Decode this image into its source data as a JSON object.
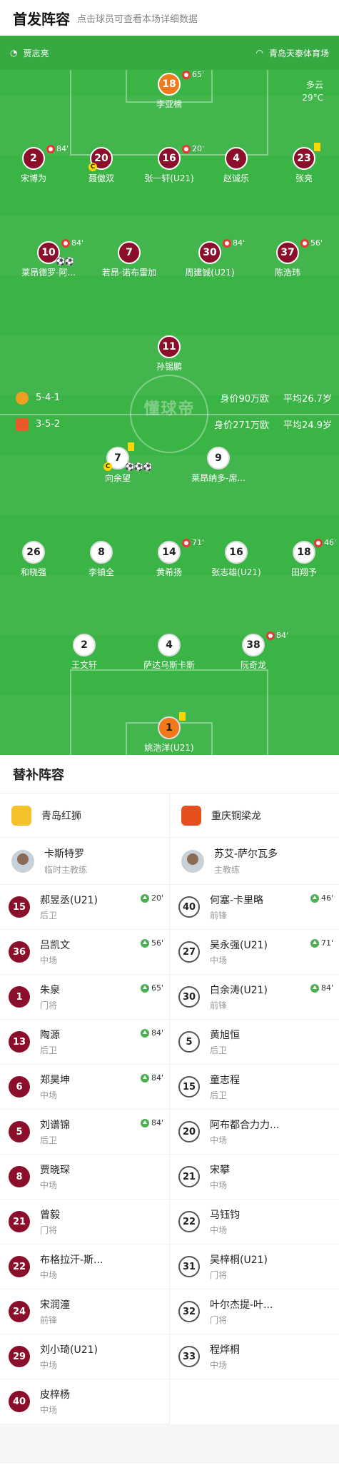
{
  "header": {
    "title": "首发阵容",
    "hint": "点击球员可查看本场详细数据"
  },
  "pitch": {
    "referee": "贾志亮",
    "venue": "青岛天泰体育场",
    "weather": "多云",
    "temperature": "29°C",
    "watermark": "懂球帝",
    "home": {
      "formation": "5-4-1",
      "value": "身价90万欧",
      "age": "平均26.7岁",
      "color": "#8b0f2a"
    },
    "away": {
      "formation": "3-5-2",
      "value": "身价271万欧",
      "age": "平均24.9岁",
      "color": "#f07a1a"
    }
  },
  "home_players": [
    {
      "num": "18",
      "name": "李亚楠",
      "sub": "65'"
    },
    {
      "num": "2",
      "name": "宋博为",
      "sub": "84'"
    },
    {
      "num": "20",
      "name": "聂傲双"
    },
    {
      "num": "16",
      "name": "张一轩(U21)",
      "sub": "20'"
    },
    {
      "num": "4",
      "name": "赵诚乐"
    },
    {
      "num": "23",
      "name": "张亮"
    },
    {
      "num": "10",
      "name": "莱昂德罗-阿...",
      "sub": "84'",
      "goals": "⚽⚽"
    },
    {
      "num": "7",
      "name": "若昂-诺布雷加"
    },
    {
      "num": "30",
      "name": "周建铖(U21)",
      "sub": "84'"
    },
    {
      "num": "37",
      "name": "陈浩玮",
      "sub": "56'"
    },
    {
      "num": "11",
      "name": "孙锡鹏"
    }
  ],
  "away_players": [
    {
      "num": "7",
      "name": "向余望",
      "goals": "⚽⚽⚽"
    },
    {
      "num": "9",
      "name": "莱昂纳多-席..."
    },
    {
      "num": "26",
      "name": "和晓强"
    },
    {
      "num": "8",
      "name": "李镇全"
    },
    {
      "num": "14",
      "name": "黄希扬",
      "sub": "71'"
    },
    {
      "num": "16",
      "name": "张志雄(U21)"
    },
    {
      "num": "18",
      "name": "田翔予",
      "sub": "46'"
    },
    {
      "num": "2",
      "name": "王文轩"
    },
    {
      "num": "4",
      "name": "萨达乌斯卡斯"
    },
    {
      "num": "38",
      "name": "阮奇龙",
      "sub": "84'"
    },
    {
      "num": "1",
      "name": "姚浩洋(U21)"
    }
  ],
  "subs": {
    "title": "替补阵容",
    "home": {
      "team": "青岛红狮",
      "coach": {
        "name": "卡斯特罗",
        "role": "临时主教练"
      },
      "players": [
        {
          "num": "15",
          "name": "郝昱丞(U21)",
          "pos": "后卫",
          "ev": "20'"
        },
        {
          "num": "36",
          "name": "吕凯文",
          "pos": "中场",
          "ev": "56'"
        },
        {
          "num": "1",
          "name": "朱泉",
          "pos": "门将",
          "ev": "65'"
        },
        {
          "num": "13",
          "name": "陶源",
          "pos": "后卫",
          "ev": "84'"
        },
        {
          "num": "6",
          "name": "郑昊坤",
          "pos": "中场",
          "ev": "84'"
        },
        {
          "num": "5",
          "name": "刘谱锦",
          "pos": "后卫",
          "ev": "84'"
        },
        {
          "num": "8",
          "name": "贾晓琛",
          "pos": "中场"
        },
        {
          "num": "21",
          "name": "曾毅",
          "pos": "门将"
        },
        {
          "num": "22",
          "name": "布格拉汗-斯...",
          "pos": "中场"
        },
        {
          "num": "24",
          "name": "宋润潼",
          "pos": "前锋"
        },
        {
          "num": "29",
          "name": "刘小琦(U21)",
          "pos": "中场"
        },
        {
          "num": "40",
          "name": "皮梓杨",
          "pos": "中场"
        }
      ]
    },
    "away": {
      "team": "重庆铜梁龙",
      "coach": {
        "name": "苏艾-萨尔瓦多",
        "role": "主教练"
      },
      "players": [
        {
          "num": "40",
          "name": "何塞-卡里略",
          "pos": "前锋",
          "ev": "46'"
        },
        {
          "num": "27",
          "name": "吴永强(U21)",
          "pos": "中场",
          "ev": "71'"
        },
        {
          "num": "30",
          "name": "白余涛(U21)",
          "pos": "前锋",
          "ev": "84'"
        },
        {
          "num": "5",
          "name": "黄旭恒",
          "pos": "后卫"
        },
        {
          "num": "15",
          "name": "童志程",
          "pos": "后卫"
        },
        {
          "num": "20",
          "name": "阿布都合力力...",
          "pos": "中场"
        },
        {
          "num": "21",
          "name": "宋攀",
          "pos": "中场"
        },
        {
          "num": "22",
          "name": "马钰钧",
          "pos": "中场"
        },
        {
          "num": "31",
          "name": "吴梓桐(U21)",
          "pos": "门将"
        },
        {
          "num": "32",
          "name": "叶尔杰提-叶...",
          "pos": "门将"
        },
        {
          "num": "33",
          "name": "程烨桐",
          "pos": "中场"
        }
      ]
    }
  }
}
